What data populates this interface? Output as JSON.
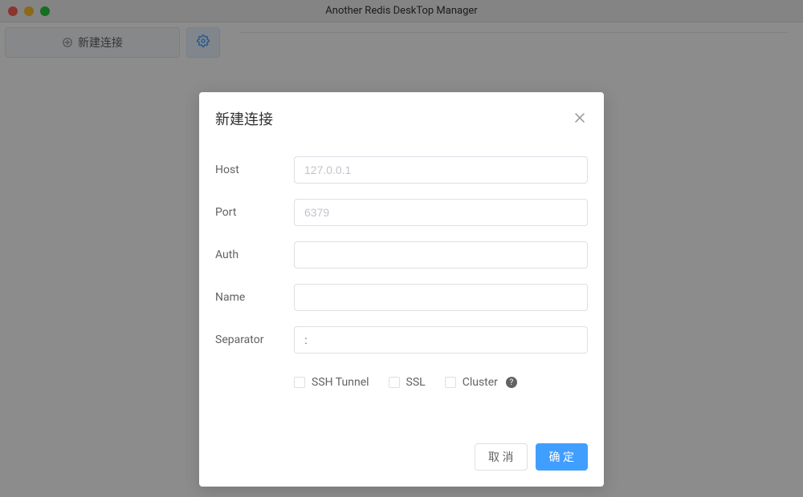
{
  "window": {
    "title": "Another Redis DeskTop Manager"
  },
  "sidebar": {
    "new_connection_label": "新建连接"
  },
  "dialog": {
    "title": "新建连接",
    "fields": {
      "host": {
        "label": "Host",
        "placeholder": "127.0.0.1",
        "value": ""
      },
      "port": {
        "label": "Port",
        "placeholder": "6379",
        "value": ""
      },
      "auth": {
        "label": "Auth",
        "placeholder": "",
        "value": ""
      },
      "name": {
        "label": "Name",
        "placeholder": "",
        "value": ""
      },
      "separator": {
        "label": "Separator",
        "placeholder": "",
        "value": ":"
      }
    },
    "checkboxes": {
      "ssh_tunnel": {
        "label": "SSH Tunnel",
        "checked": false
      },
      "ssl": {
        "label": "SSL",
        "checked": false
      },
      "cluster": {
        "label": "Cluster",
        "checked": false
      }
    },
    "buttons": {
      "cancel": "取 消",
      "confirm": "确 定"
    }
  }
}
